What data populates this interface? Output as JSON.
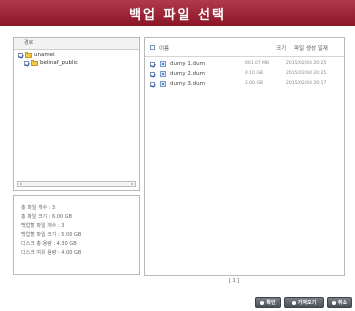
{
  "window": {
    "title": "백업 파일 선택"
  },
  "tree": {
    "header": "경로",
    "items": [
      {
        "label": "unamei"
      },
      {
        "label": "belinaf_public"
      }
    ]
  },
  "info": {
    "lines": [
      "총 파일 개수 : 3",
      "총 파일 크기 : 6.00 GB",
      "백업할 파일 개수 : 3",
      "백업할 파일 크기 : 5.00 GB",
      "디스크 총 용량 : 4.30 GB",
      "디스크 여유 용량 : 4.00 GB"
    ]
  },
  "file_list": {
    "columns": {
      "name": "이름",
      "size": "크기",
      "date": "파일 생성 일재"
    },
    "rows": [
      {
        "name": "dumy 1.dum",
        "size": "601.07 MB",
        "date": "2015/02/04 20:25",
        "checked": true
      },
      {
        "name": "dumy 2.dum",
        "size": "4.10 GB",
        "date": "2015/02/04 20:25",
        "checked": true
      },
      {
        "name": "dumy 3.dum",
        "size": "2.00 GB",
        "date": "2015/02/04 20:17",
        "checked": true
      }
    ]
  },
  "paging": {
    "label": "[ 1 ]"
  },
  "buttons": {
    "ok": "확인",
    "prev": "가져오기",
    "cancel": "취소"
  },
  "colors": {
    "title_bar": "#9e2334",
    "button": "#5a5f66"
  }
}
